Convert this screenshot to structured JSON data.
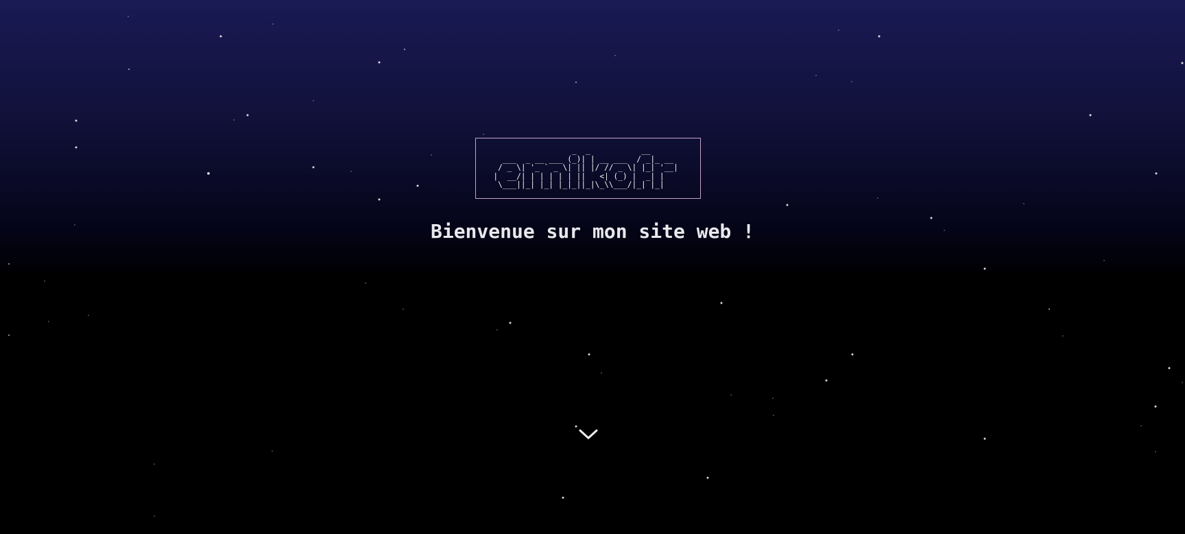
{
  "logo": {
    "ascii_art": "                 _  _           __       \n  ___  _ __ ___ (_)| | __ ___  / _|_ __  \n / _ \\| '_ ` _ \\| || |/ // _ \\| |_| '__| \n|  __/| | | | | | ||   <| (_) |  _| |    \n \\___||_| |_| |_|_||_|\\_\\\\___/|_| |_|    "
  },
  "hero": {
    "welcome_text": "Bienvenue sur mon site web !"
  },
  "scroll_down": {
    "icon": "chevron-down-icon"
  },
  "colors": {
    "background_top": "#1a1a55",
    "background_bottom": "#000000",
    "logo_border": "#c9a3c4",
    "text": "#e8e8ee",
    "stars": "#ffffff"
  }
}
